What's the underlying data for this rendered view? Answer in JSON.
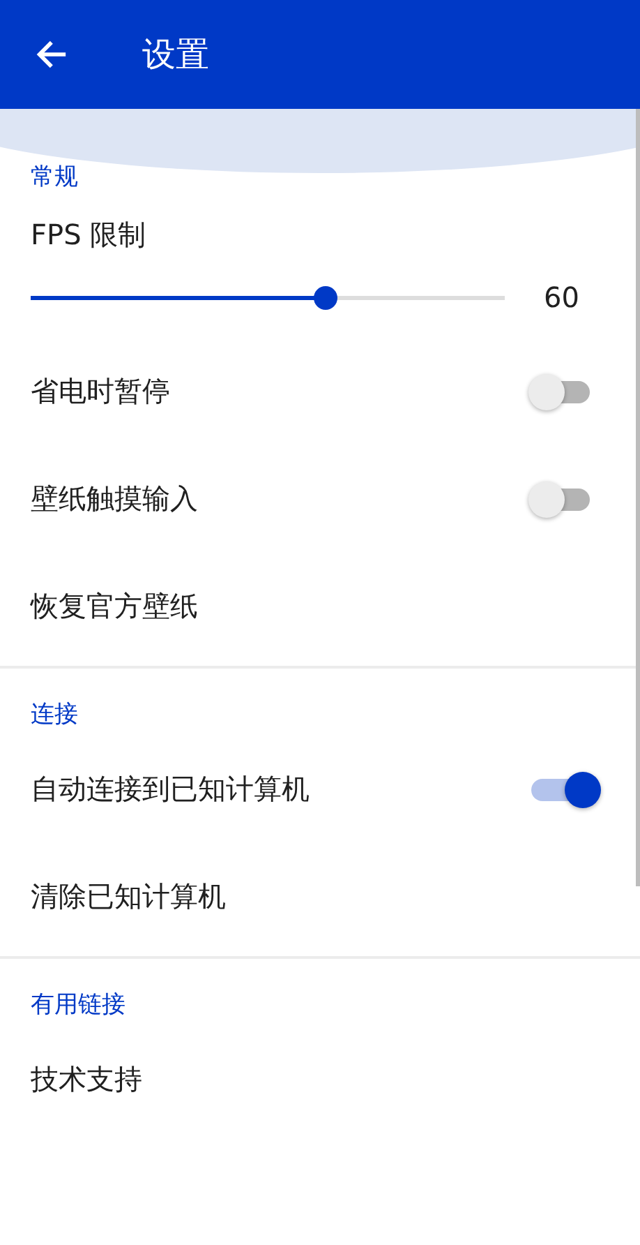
{
  "app_bar": {
    "title": "设置"
  },
  "sections": [
    {
      "title": "常规",
      "items": [
        {
          "kind": "slider",
          "label": "FPS 限制",
          "level": 0.63,
          "reading": "60"
        },
        {
          "kind": "toggle",
          "label": "省电时暂停",
          "on": false
        },
        {
          "kind": "toggle",
          "label": "壁纸触摸输入",
          "on": false
        },
        {
          "kind": "action",
          "label": "恢复官方壁纸"
        }
      ]
    },
    {
      "title": "连接",
      "items": [
        {
          "kind": "toggle",
          "label": "自动连接到已知计算机",
          "on": true
        },
        {
          "kind": "action",
          "label": "清除已知计算机"
        }
      ]
    },
    {
      "title": "有用链接",
      "items": [
        {
          "kind": "action",
          "label": "技术支持"
        }
      ]
    }
  ]
}
